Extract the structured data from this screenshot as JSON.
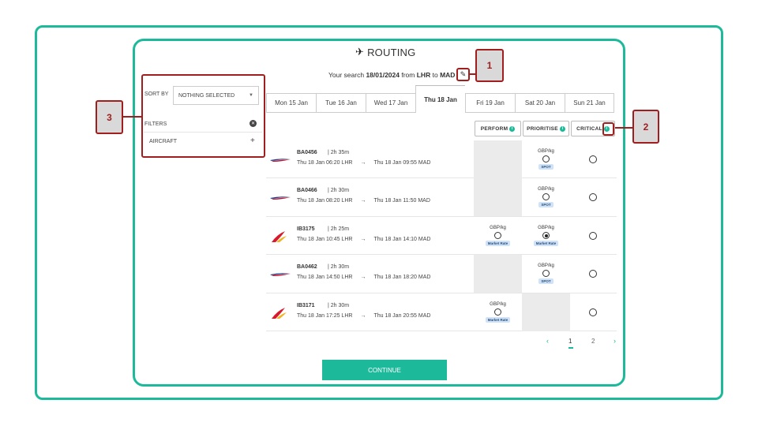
{
  "header": {
    "title": "ROUTING"
  },
  "search": {
    "prefix": "Your search",
    "date": "18/01/2024",
    "from_word": "from",
    "origin": "LHR",
    "to_word": "to",
    "destination": "MAD"
  },
  "sidebar": {
    "sort_label": "SORT BY",
    "sort_value": "NOTHING SELECTED",
    "filters_label": "FILTERS",
    "aircraft_label": "AIRCRAFT"
  },
  "date_tabs": [
    "Mon 15 Jan",
    "Tue 16 Jan",
    "Wed 17 Jan",
    "Thu 18 Jan",
    "Fri 19 Jan",
    "Sat 20 Jan",
    "Sun 21 Jan"
  ],
  "active_tab": "Thu 18 Jan",
  "columns": {
    "perform": "PERFORM",
    "prioritise": "PRIORITISE",
    "critical": "CRITICAL"
  },
  "flights": [
    {
      "airline": "ba",
      "number": "BA0456",
      "duration": "| 2h 35m",
      "depart": "Thu 18 Jan 06:20 LHR",
      "arrive": "Thu 18 Jan 09:55 MAD",
      "perform": null,
      "prioritise": {
        "unit": "GBP/kg",
        "tag": "SPOT",
        "selected": false
      }
    },
    {
      "airline": "ba",
      "number": "BA0466",
      "duration": "| 2h 30m",
      "depart": "Thu 18 Jan 08:20 LHR",
      "arrive": "Thu 18 Jan 11:50 MAD",
      "perform": null,
      "prioritise": {
        "unit": "GBP/kg",
        "tag": "SPOT",
        "selected": false
      }
    },
    {
      "airline": "ib",
      "number": "IB3175",
      "duration": "| 2h 25m",
      "depart": "Thu 18 Jan 10:45 LHR",
      "arrive": "Thu 18 Jan 14:10 MAD",
      "perform": {
        "unit": "GBP/kg",
        "tag": "Market Rate",
        "selected": false
      },
      "prioritise": {
        "unit": "GBP/kg",
        "tag": "Market Rate",
        "selected": true
      }
    },
    {
      "airline": "ba",
      "number": "BA0462",
      "duration": "| 2h 30m",
      "depart": "Thu 18 Jan 14:50 LHR",
      "arrive": "Thu 18 Jan 18:20 MAD",
      "perform": null,
      "prioritise": {
        "unit": "GBP/kg",
        "tag": "SPOT",
        "selected": false
      }
    },
    {
      "airline": "ib",
      "number": "IB3171",
      "duration": "| 2h 30m",
      "depart": "Thu 18 Jan 17:25 LHR",
      "arrive": "Thu 18 Jan 20:55 MAD",
      "perform": {
        "unit": "GBP/kg",
        "tag": "Market Rate",
        "selected": false
      },
      "prioritise": null
    }
  ],
  "arrow": "→",
  "pagination": {
    "prev": "‹",
    "pages": [
      "1",
      "2"
    ],
    "next": "›",
    "current": "1"
  },
  "continue_label": "CONTINUE",
  "callouts": [
    "1",
    "2",
    "3"
  ],
  "colors": {
    "accent": "#1cb99a",
    "callout_border": "#a01e1e",
    "tag_bg": "#cfe2f7"
  }
}
